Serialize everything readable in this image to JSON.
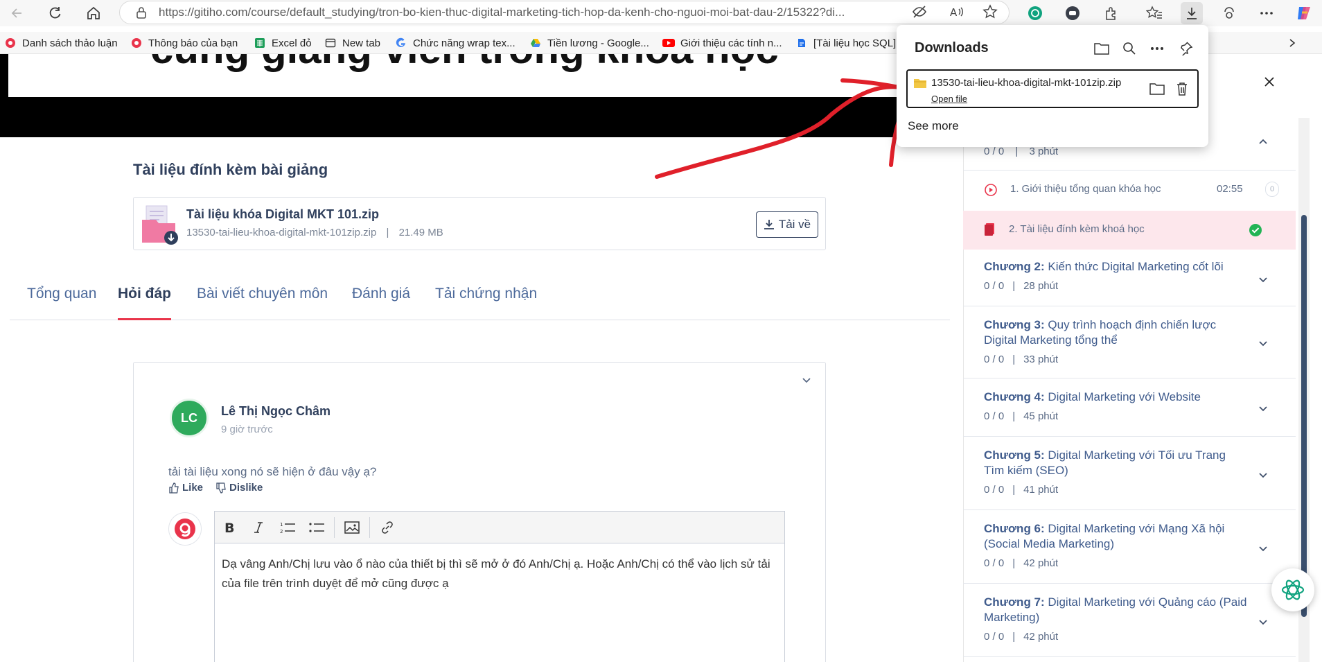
{
  "browser": {
    "url": "https://gitiho.com/course/default_studying/tron-bo-kien-thuc-digital-marketing-tich-hop-da-kenh-cho-nguoi-moi-bat-dau-2/15322?di...",
    "bookmarks": [
      {
        "label": "Danh sách thảo luận",
        "icon": "gitiho-icon"
      },
      {
        "label": "Thông báo của bạn",
        "icon": "gitiho-icon"
      },
      {
        "label": "Excel đỏ",
        "icon": "sheets-icon"
      },
      {
        "label": "New tab",
        "icon": "newtab-icon"
      },
      {
        "label": "Chức năng wrap tex...",
        "icon": "google-icon"
      },
      {
        "label": "Tiền lương - Google...",
        "icon": "drive-icon"
      },
      {
        "label": "Giới thiệu các tính n...",
        "icon": "youtube-icon"
      },
      {
        "label": "[Tài liệu học SQL]",
        "icon": "doc-icon"
      }
    ]
  },
  "downloads": {
    "title": "Downloads",
    "file_name": "13530-tai-lieu-khoa-digital-mkt-101zip.zip",
    "open_file": "Open file",
    "see_more": "See more"
  },
  "hero": {
    "title": "cùng giảng viên trong khóa học"
  },
  "attachment": {
    "heading": "Tài liệu đính kèm bài giảng",
    "file_title": "Tài liệu khóa Digital MKT 101.zip",
    "file_name": "13530-tai-lieu-khoa-digital-mkt-101zip.zip",
    "separator": "|",
    "file_size": "21.49 MB",
    "download_label": "Tải về"
  },
  "tabs": [
    {
      "label": "Tổng quan",
      "active": false
    },
    {
      "label": "Hỏi đáp",
      "active": true
    },
    {
      "label": "Bài viết chuyên môn",
      "active": false
    },
    {
      "label": "Đánh giá",
      "active": false
    },
    {
      "label": "Tải chứng nhận",
      "active": false
    }
  ],
  "question": {
    "avatar_initials": "LC",
    "author": "Lê Thị Ngọc Châm",
    "time": "9 giờ trước",
    "text": "tải tài liệu xong nó sẽ hiện ở đâu vậy ạ?",
    "like": "Like",
    "dislike": "Dislike"
  },
  "reply": {
    "text": "Dạ vâng Anh/Chị lưu vào ổ nào của thiết bị thì sẽ mở ở đó Anh/Chị ạ. Hoặc Anh/Chị có thể vào lịch sử tải của file trên trình duyệt để mở cũng được ạ"
  },
  "sidebar": {
    "chapter1_meta": {
      "count": "0 / 0",
      "sep": "|",
      "duration": "3 phút"
    },
    "lessons": [
      {
        "label": "1. Giới thiệu tổng quan khóa học",
        "duration": "02:55",
        "badge": "0"
      },
      {
        "label": "2. Tài liệu đính kèm khoá học",
        "duration": "",
        "badge": ""
      }
    ],
    "chapters": [
      {
        "prefix": "Chương 2:",
        "title": "Kiến thức Digital Marketing cốt lõi",
        "count": "0 / 0",
        "sep": "|",
        "duration": "28 phút"
      },
      {
        "prefix": "Chương 3:",
        "title": "Quy trình hoạch định chiến lược Digital Marketing tổng thể",
        "count": "0 / 0",
        "sep": "|",
        "duration": "33 phút"
      },
      {
        "prefix": "Chương 4:",
        "title": "Digital Marketing với Website",
        "count": "0 / 0",
        "sep": "|",
        "duration": "45 phút"
      },
      {
        "prefix": "Chương 5:",
        "title": "Digital Marketing với Tối ưu Trang Tìm kiếm (SEO)",
        "count": "0 / 0",
        "sep": "|",
        "duration": "41 phút"
      },
      {
        "prefix": "Chương 6:",
        "title": "Digital Marketing với Mạng Xã hội (Social Media Marketing)",
        "count": "0 / 0",
        "sep": "|",
        "duration": "42 phút"
      },
      {
        "prefix": "Chương 7:",
        "title": "Digital Marketing với Quảng cáo (Paid Marketing)",
        "count": "0 / 0",
        "sep": "|",
        "duration": "42 phút"
      }
    ]
  },
  "colors": {
    "accent": "#e9344b",
    "navy": "#2f3f5c",
    "annotation": "#e0202a"
  }
}
